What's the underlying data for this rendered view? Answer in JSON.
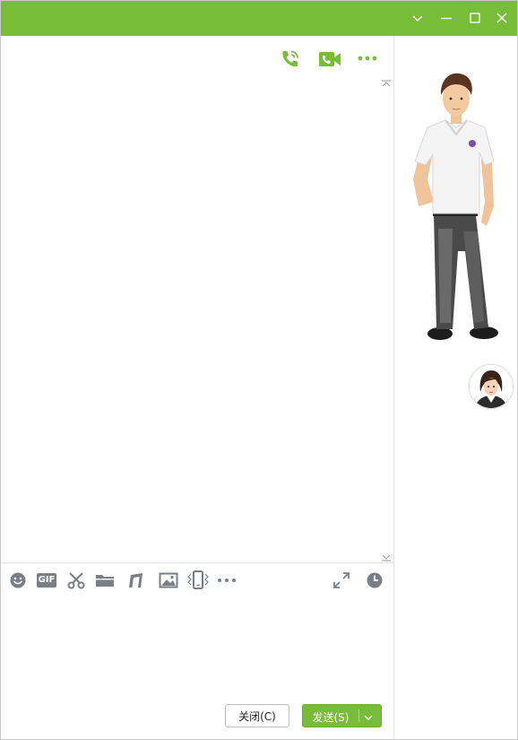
{
  "colors": {
    "brand_green": "#78bd38",
    "icon_gray": "#7a7f85",
    "border_gray": "#c9c9c9"
  },
  "titlebar": {
    "icons": [
      "chevron-down-icon",
      "minimize-icon",
      "maximize-icon",
      "close-icon"
    ]
  },
  "chat_header": {
    "icons": [
      "phone-call-icon",
      "video-call-icon",
      "more-dots-icon"
    ]
  },
  "input_toolbar": {
    "left_icons": [
      "emoji-icon",
      "gif-icon",
      "scissors-icon",
      "folder-icon",
      "music-note-icon",
      "image-icon",
      "shake-window-icon",
      "more-dots-icon"
    ],
    "gif_label": "GIF",
    "right_icons": [
      "expand-icon",
      "history-clock-icon"
    ]
  },
  "actions": {
    "close_label": "关闭(C)",
    "send_label": "发送(S)"
  },
  "show_avatar": {
    "large": "male-3d-avatar",
    "small": "female-avatar"
  }
}
